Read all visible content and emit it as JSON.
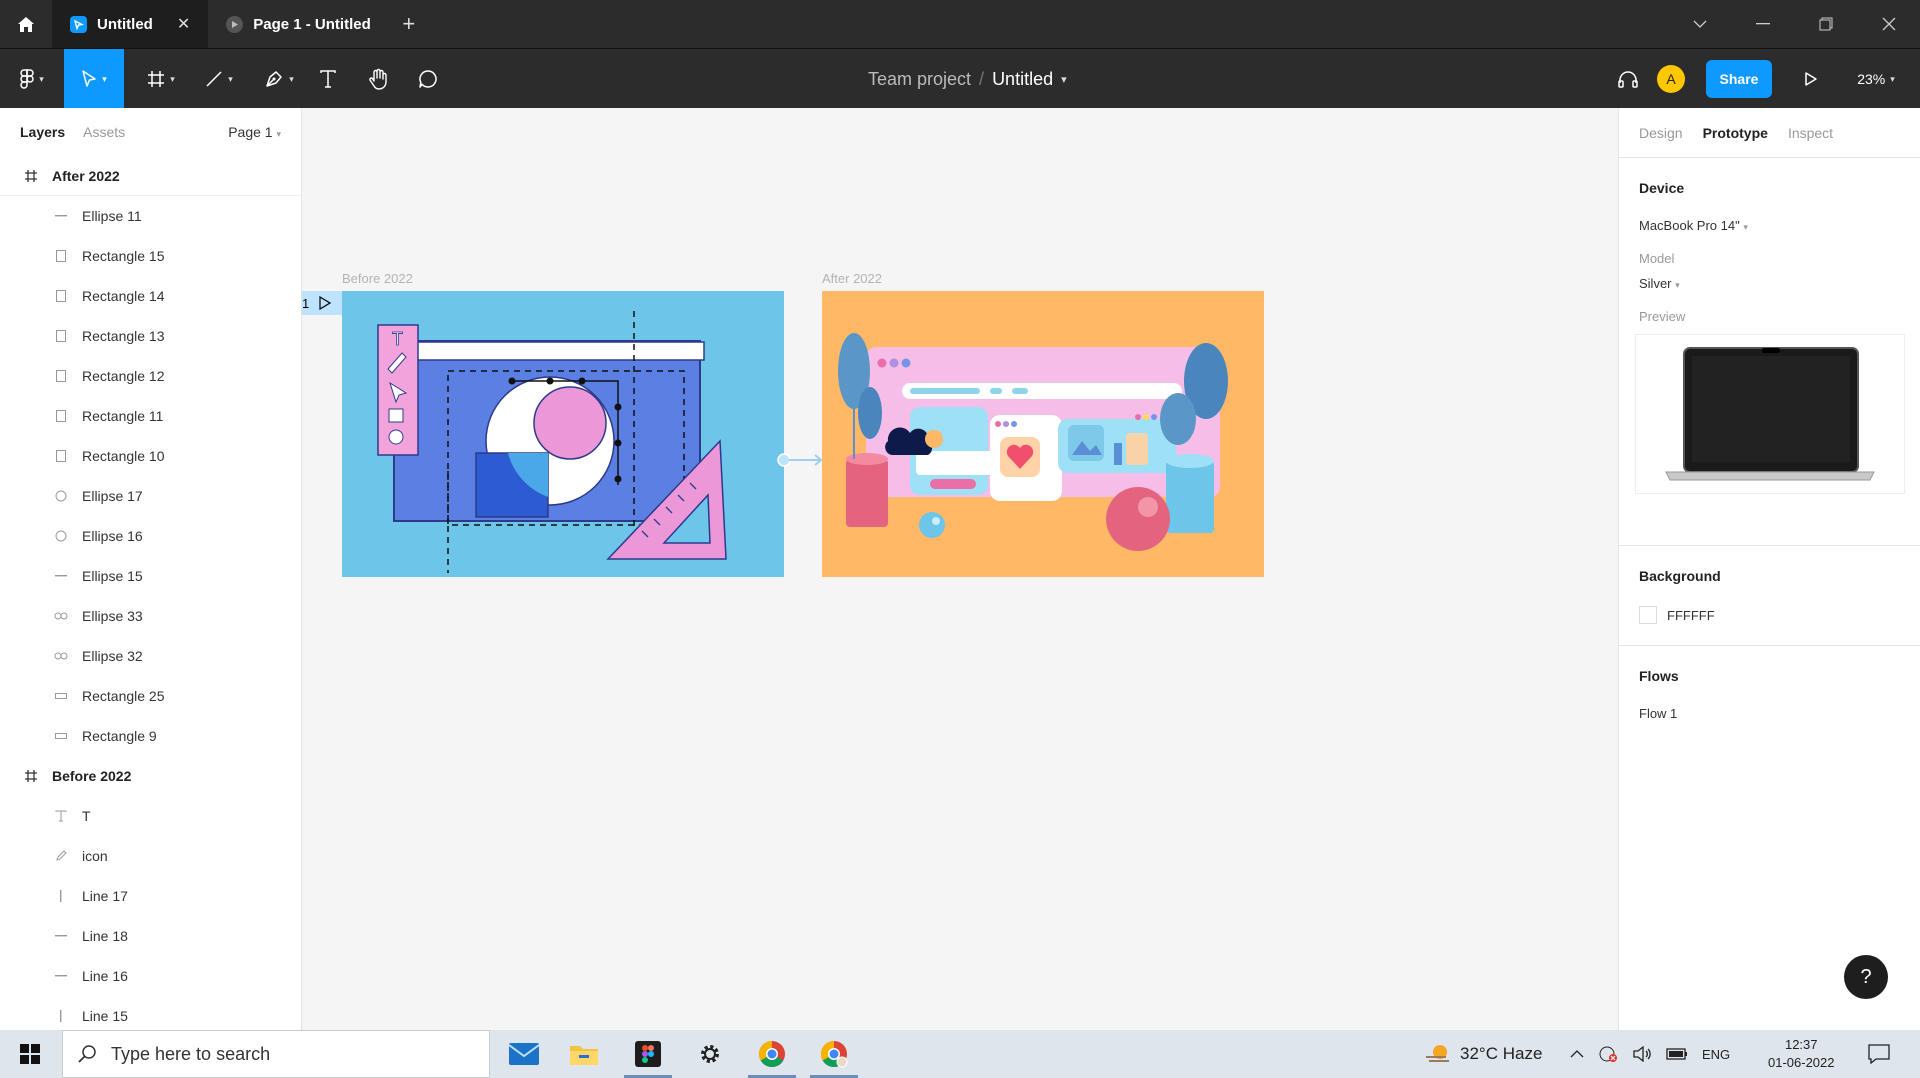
{
  "titlebar": {
    "tabs": [
      {
        "label": "Untitled",
        "active": true
      },
      {
        "label": "Page 1 - Untitled",
        "active": false
      }
    ],
    "add_tab": "+",
    "controls": {
      "menu": "⌵",
      "minimize": "—",
      "restore": "❐",
      "close": "✕"
    }
  },
  "toolbar": {
    "project": "Team project",
    "separator": "/",
    "file": "Untitled",
    "avatar_letter": "A",
    "share_label": "Share",
    "zoom": "23%",
    "accent": "#0d99ff"
  },
  "left_panel": {
    "tabs": [
      "Layers",
      "Assets"
    ],
    "page": "Page 1",
    "layers": [
      {
        "name": "After 2022",
        "kind": "frame",
        "icon": "frame-icon"
      },
      {
        "name": "Ellipse 11",
        "kind": "child",
        "icon": "line-icon"
      },
      {
        "name": "Rectangle 15",
        "kind": "child",
        "icon": "rectangle-icon"
      },
      {
        "name": "Rectangle 14",
        "kind": "child",
        "icon": "rectangle-icon"
      },
      {
        "name": "Rectangle 13",
        "kind": "child",
        "icon": "rectangle-icon"
      },
      {
        "name": "Rectangle 12",
        "kind": "child",
        "icon": "rectangle-icon"
      },
      {
        "name": "Rectangle 11",
        "kind": "child",
        "icon": "rectangle-icon"
      },
      {
        "name": "Rectangle 10",
        "kind": "child",
        "icon": "rectangle-icon"
      },
      {
        "name": "Ellipse 17",
        "kind": "child",
        "icon": "ellipse-icon"
      },
      {
        "name": "Ellipse 16",
        "kind": "child",
        "icon": "ellipse-icon"
      },
      {
        "name": "Ellipse 15",
        "kind": "child",
        "icon": "line-icon"
      },
      {
        "name": "Ellipse 33",
        "kind": "child",
        "icon": "double-ellipse-icon"
      },
      {
        "name": "Ellipse 32",
        "kind": "child",
        "icon": "double-ellipse-icon"
      },
      {
        "name": "Rectangle 25",
        "kind": "child",
        "icon": "flat-rectangle-icon"
      },
      {
        "name": "Rectangle 9",
        "kind": "child",
        "icon": "flat-rectangle-icon"
      },
      {
        "name": "Before 2022",
        "kind": "frame",
        "icon": "frame-icon"
      },
      {
        "name": "T",
        "kind": "child",
        "icon": "text-icon"
      },
      {
        "name": "icon",
        "kind": "child",
        "icon": "pen-icon"
      },
      {
        "name": "Line 17",
        "kind": "child",
        "icon": "vertical-line-icon"
      },
      {
        "name": "Line 18",
        "kind": "child",
        "icon": "line-icon"
      },
      {
        "name": "Line 16",
        "kind": "child",
        "icon": "line-icon"
      },
      {
        "name": "Line 15",
        "kind": "child",
        "icon": "vertical-line-icon"
      }
    ]
  },
  "canvas": {
    "frames": [
      {
        "label": "Before 2022"
      },
      {
        "label": "After 2022"
      }
    ],
    "flow_number": "1"
  },
  "right_panel": {
    "tabs": [
      "Design",
      "Prototype",
      "Inspect"
    ],
    "active_tab": "Prototype",
    "device": {
      "title": "Device",
      "value": "MacBook Pro 14\""
    },
    "model": {
      "label": "Model",
      "value": "Silver"
    },
    "preview": {
      "label": "Preview"
    },
    "background": {
      "title": "Background",
      "value": "FFFFFF"
    },
    "flows": {
      "title": "Flows",
      "value": "Flow 1"
    },
    "help": "?"
  },
  "taskbar": {
    "search_placeholder": "Type here to search",
    "weather": "32°C  Haze",
    "lang": "ENG",
    "time": "12:37",
    "date": "01-06-2022"
  }
}
